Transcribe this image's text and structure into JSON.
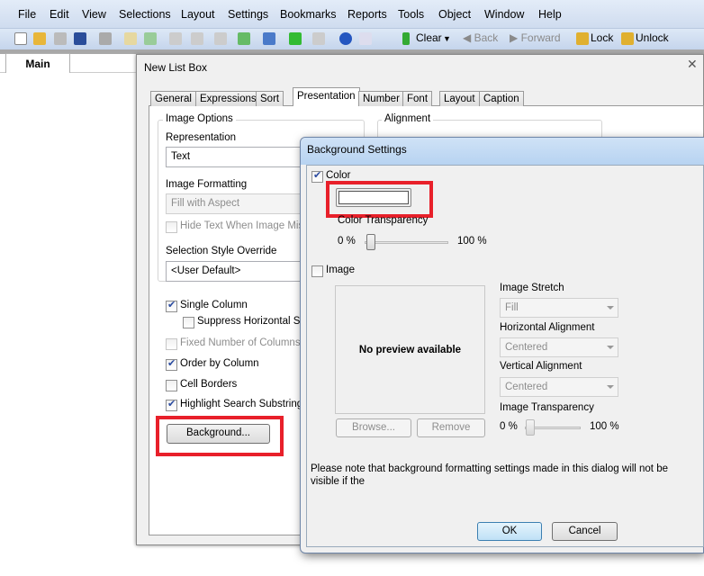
{
  "menu": [
    "File",
    "Edit",
    "View",
    "Selections",
    "Layout",
    "Settings",
    "Bookmarks",
    "Reports",
    "Tools",
    "Object",
    "Window",
    "Help"
  ],
  "toolbar": {
    "clear": "Clear",
    "back": "Back",
    "forward": "Forward",
    "lock": "Lock",
    "unlock": "Unlock"
  },
  "sheet_tab": "Main",
  "list_box": {
    "title": "New List Box",
    "tabs": [
      "General",
      "Expressions",
      "Sort",
      "Presentation",
      "Number",
      "Font",
      "Layout",
      "Caption"
    ],
    "active_tab": "Presentation",
    "image_options": "Image Options",
    "representation_label": "Representation",
    "representation_value": "Text",
    "image_formatting_label": "Image Formatting",
    "image_formatting_value": "Fill with Aspect",
    "hide_text": "Hide Text When Image Missing",
    "selection_style_label": "Selection Style Override",
    "selection_style_value": "<User Default>",
    "single_column": "Single Column",
    "suppress_scroll": "Suppress Horizontal Scrollbar",
    "fixed_columns": "Fixed Number of Columns",
    "order_by_column": "Order by Column",
    "cell_borders": "Cell Borders",
    "highlight_search": "Highlight Search Substring",
    "background_button": "Background...",
    "alignment": "Alignment"
  },
  "bg_settings": {
    "title": "Background Settings",
    "color_label": "Color",
    "color_checked": true,
    "color_value": "#ffffff",
    "color_transparency": "Color Transparency",
    "min": "0 %",
    "max": "100 %",
    "color_transparency_value": 0,
    "image_label": "Image",
    "image_checked": false,
    "no_preview": "No preview available",
    "browse": "Browse...",
    "remove": "Remove",
    "image_stretch_label": "Image Stretch",
    "image_stretch_value": "Fill",
    "h_align_label": "Horizontal Alignment",
    "h_align_value": "Centered",
    "v_align_label": "Vertical Alignment",
    "v_align_value": "Centered",
    "image_transparency": "Image Transparency",
    "image_transparency_value": 0,
    "note": "Please note that background formatting settings made in this dialog will not be visible if the",
    "ok": "OK",
    "cancel": "Cancel"
  },
  "highlight_color": "#e8202a"
}
